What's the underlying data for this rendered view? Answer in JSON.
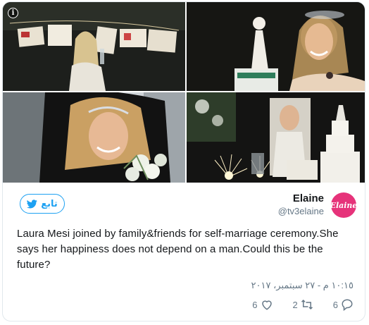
{
  "tweet": {
    "author": {
      "display_name": "Elaine",
      "handle": "@tv3elaine",
      "avatar_text": "Elaine",
      "avatar_color": "#e6337a"
    },
    "follow_label": "تابع",
    "text": "Laura Mesi joined by family&friends for self-marriage ceremony.She says her happiness does not depend on a man.Could this be the future?",
    "timestamp": "١٠:١٥ م - ٢٧ سبتمبر، ٢٠١٧",
    "actions": {
      "reply_count": "6",
      "retweet_count": "2",
      "like_count": "6"
    },
    "accent_color": "#1da1f2",
    "media": [
      {
        "icon": "photo-clothesline"
      },
      {
        "icon": "photo-cake-smile"
      },
      {
        "icon": "photo-car-bouquet"
      },
      {
        "icon": "photo-sparklers"
      }
    ]
  }
}
